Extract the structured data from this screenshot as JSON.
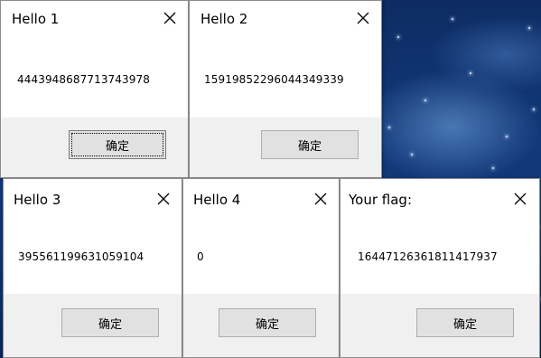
{
  "dialogs": [
    {
      "title": "Hello 1",
      "message": "4443948687713743978",
      "ok_label": "确定"
    },
    {
      "title": "Hello 2",
      "message": "15919852296044349339",
      "ok_label": "确定"
    },
    {
      "title": "Hello 3",
      "message": "395561199631059104",
      "ok_label": "确定"
    },
    {
      "title": "Hello 4",
      "message": "0",
      "ok_label": "确定"
    },
    {
      "title": "Your flag:",
      "message": "16447126361811417937",
      "ok_label": "确定"
    }
  ],
  "icons": {
    "close": "close-icon"
  },
  "colors": {
    "dialog_body": "#ffffff",
    "dialog_footer": "#f0f0f0",
    "button_face": "#e1e1e1",
    "desktop_background": "#12397a"
  }
}
